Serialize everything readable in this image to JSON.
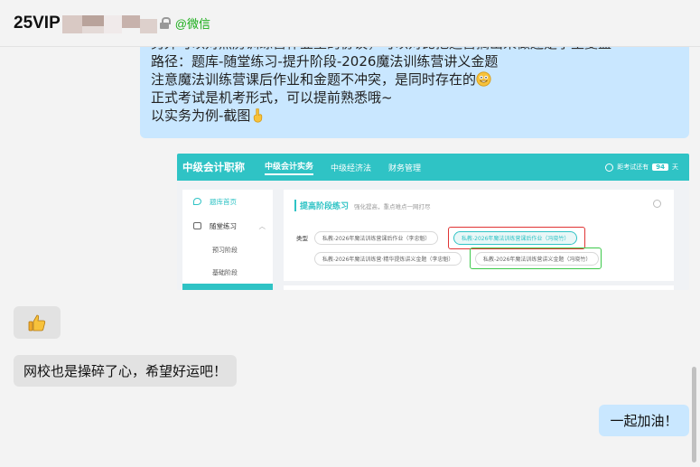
{
  "header": {
    "chat_title": "25VIP",
    "wechat_tag": "@微信"
  },
  "messages": {
    "long": {
      "cut_line": "另外可以对照历训练营作业里的协议，可以对比把运营搞出来做还是学生复盘",
      "lines": [
        "路径：题库-随堂练习-提升阶段-2026魔法训练营讲义金题",
        "注意魔法训练营课后作业和金题不冲突，是同时存在的",
        "正式考试是机考形式，可以提前熟悉哦~",
        "以实务为例-截图"
      ]
    },
    "incoming_text": "网校也是操碎了心，希望好运吧！",
    "outgoing_text": "一起加油！"
  },
  "screenshot": {
    "brand": "中级会计职称",
    "nav": [
      "中级会计实务",
      "中级经济法",
      "财务管理"
    ],
    "countdown_label": "距考试还有",
    "countdown_days": "94",
    "countdown_unit": "天",
    "sidebar": [
      "题库首页",
      "随堂练习",
      "预习阶段",
      "基础阶段"
    ],
    "section_title": "提高阶段练习",
    "section_hint": "强化提高，重点难点一网打尽",
    "type_label": "类型",
    "pills": [
      "私教-2026年魔法训练营课后作业（李忠魁）",
      "私教-2026年魔法训练营课后作业（冯晓竹）",
      "私教-2026年魔法训练营·精华提炼讲义金题（李忠魁）",
      "私教-2026年魔法训练营讲义金题（冯晓竹）"
    ]
  },
  "colors": {
    "bubble_out": "#c9e7ff",
    "bubble_in": "#e2e2e2",
    "wechat_green": "#1aad19",
    "shot_teal": "#2fc3c5",
    "box_red": "#e03434",
    "box_green": "#3dc94b"
  },
  "icons": {
    "lock": "lock-icon",
    "thumbs_up": "thumbs-up-emoji",
    "grinning": "grin-emoji",
    "pointing_down": "pointing-down-emoji"
  }
}
